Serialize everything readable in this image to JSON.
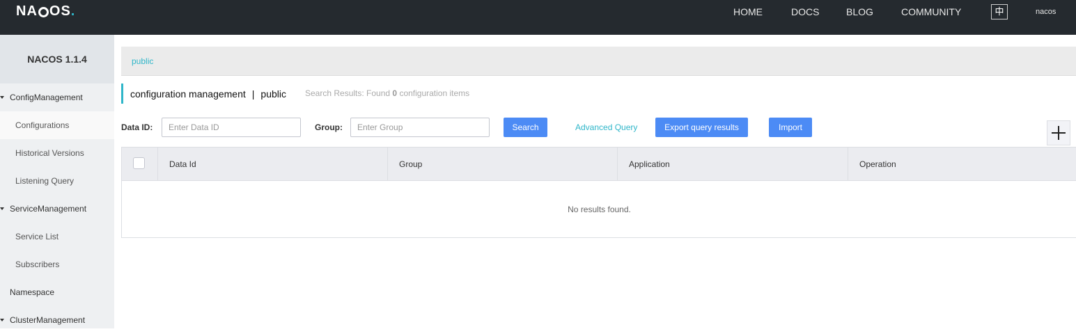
{
  "topbar": {
    "logo_text": "NACOS.",
    "nav": [
      "HOME",
      "DOCS",
      "BLOG",
      "COMMUNITY"
    ],
    "lang": "中",
    "user": "nacos"
  },
  "sidebar": {
    "title": "NACOS 1.1.4",
    "items": [
      {
        "label": "ConfigManagement",
        "kind": "group"
      },
      {
        "label": "Configurations",
        "kind": "sub",
        "active": true
      },
      {
        "label": "Historical Versions",
        "kind": "sub"
      },
      {
        "label": "Listening Query",
        "kind": "sub"
      },
      {
        "label": "ServiceManagement",
        "kind": "group"
      },
      {
        "label": "Service List",
        "kind": "sub"
      },
      {
        "label": "Subscribers",
        "kind": "sub"
      },
      {
        "label": "Namespace",
        "kind": "plain"
      },
      {
        "label": "ClusterManagement",
        "kind": "group"
      }
    ]
  },
  "namespace_bar": {
    "active": "public"
  },
  "header": {
    "title": "configuration management",
    "separator": "|",
    "namespace": "public",
    "result_prefix": "Search Results: Found",
    "result_count": "0",
    "result_suffix": "configuration items"
  },
  "filters": {
    "data_id_label": "Data ID:",
    "data_id_placeholder": "Enter Data ID",
    "data_id_value": "",
    "group_label": "Group:",
    "group_placeholder": "Enter Group",
    "group_value": "",
    "search_label": "Search",
    "advanced_label": "Advanced Query",
    "export_label": "Export query results",
    "import_label": "Import"
  },
  "table": {
    "columns": [
      "Data Id",
      "Group",
      "Application",
      "Operation"
    ],
    "rows": [],
    "empty_text": "No results found."
  },
  "colors": {
    "topbar": "#252a2f",
    "accent": "#2fb6c9",
    "primary_button": "#4c8bf5",
    "sidebar": "#eef0f2"
  }
}
